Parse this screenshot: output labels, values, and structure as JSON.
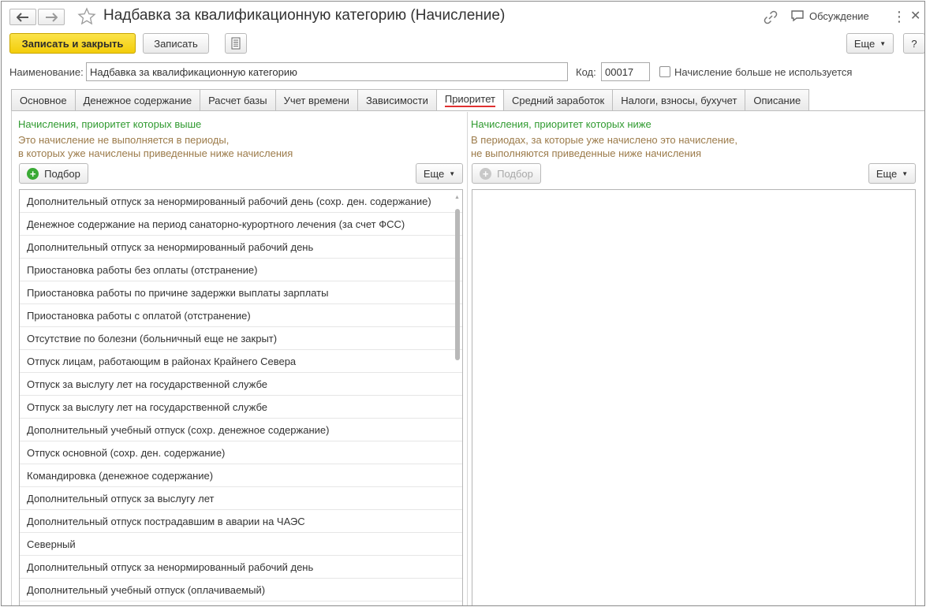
{
  "header": {
    "title": "Надбавка за квалификационную категорию (Начисление)",
    "discuss_label": "Обсуждение"
  },
  "toolbar": {
    "save_close_label": "Записать и закрыть",
    "save_label": "Записать",
    "more_label": "Еще",
    "help_label": "?"
  },
  "form": {
    "name_label": "Наименование:",
    "name_value": "Надбавка за квалификационную категорию",
    "code_label": "Код:",
    "code_value": "00017",
    "unused_label": "Начисление больше не используется"
  },
  "tabs": [
    {
      "label": "Основное"
    },
    {
      "label": "Денежное содержание"
    },
    {
      "label": "Расчет базы"
    },
    {
      "label": "Учет времени"
    },
    {
      "label": "Зависимости"
    },
    {
      "label": "Приоритет",
      "active": true
    },
    {
      "label": "Средний заработок"
    },
    {
      "label": "Налоги, взносы, бухучет"
    },
    {
      "label": "Описание"
    }
  ],
  "left": {
    "heading": "Начисления, приоритет которых выше",
    "hint1": "Это начисление не выполняется в периоды,",
    "hint2": "в которых уже начислены приведенные ниже начисления",
    "pick_label": "Подбор",
    "more_label": "Еще",
    "items": [
      "Дополнительный отпуск за ненормированный рабочий день (сохр. ден. содержание)",
      "Денежное содержание на период санаторно-курортного лечения (за счет ФСС)",
      "Дополнительный отпуск за ненормированный рабочий день",
      "Приостановка работы без оплаты (отстранение)",
      "Приостановка работы по причине задержки выплаты зарплаты",
      "Приостановка работы с оплатой (отстранение)",
      "Отсутствие по болезни (больничный еще не закрыт)",
      "Отпуск лицам, работающим в районах Крайнего Севера",
      "Отпуск за выслугу лет на государственной службе",
      "Отпуск за выслугу лет на государственной службе",
      "Дополнительный учебный отпуск (сохр. денежное содержание)",
      "Отпуск основной (сохр. ден. содержание)",
      "Командировка (денежное содержание)",
      "Дополнительный отпуск за выслугу лет",
      "Дополнительный отпуск пострадавшим в аварии на ЧАЭС",
      "Северный",
      "Дополнительный отпуск за ненормированный рабочий день",
      "Дополнительный учебный отпуск (оплачиваемый)"
    ]
  },
  "right": {
    "heading": "Начисления, приоритет которых ниже",
    "hint1": "В периодах, за которые уже начислено это начисление,",
    "hint2": "не выполняются приведенные ниже начисления",
    "pick_label": "Подбор",
    "more_label": "Еще"
  },
  "colors": {
    "accent_yellow": "#f5d20f",
    "heading_green": "#2f9a2f",
    "hint_brown": "#9c7b4a",
    "active_tab_underline": "#e03030"
  }
}
